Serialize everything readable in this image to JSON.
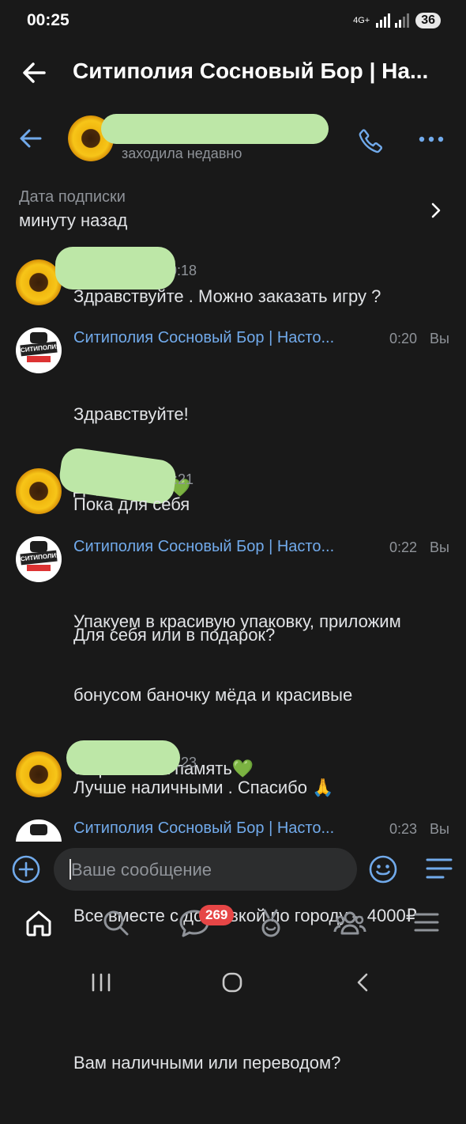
{
  "status": {
    "time": "00:25",
    "network": "4G+",
    "battery": "36"
  },
  "top": {
    "title": "Ситиполия Сосновый Бор | На..."
  },
  "chat": {
    "status": "заходила недавно"
  },
  "subscription": {
    "label": "Дата подписки",
    "value": "минуту назад"
  },
  "messages": [
    {
      "time": "0:18",
      "text": "Здравствуйте . Можно заказать игру ?"
    },
    {
      "author": "Ситиполия Сосновый Бор | Насто...",
      "time": "0:20",
      "you": "Вы",
      "lines": [
        "Здравствуйте!",
        "Да, конечно💚",
        "",
        "Для себя или в подарок?"
      ]
    },
    {
      "time": "0:21",
      "text": "Пока для себя"
    },
    {
      "author": "Ситиполия Сосновый Бор | Насто...",
      "time": "0:22",
      "you": "Вы",
      "lines": [
        "Упакуем в красивую упаковку, приложим",
        "бонусом баночку мёда и красивые",
        "открытки на память💚",
        "",
        "Все вместе с доставкой по городу – 4000₽",
        "",
        "Вам наличными или переводом?"
      ]
    },
    {
      "time": "0:23",
      "text": "Лучше наличными . Спасибо 🙏"
    },
    {
      "author": "Ситиполия Сосновый Бор | Насто...",
      "time": "0:23",
      "you": "Вы"
    }
  ],
  "logo_text": "СИТИПОЛИЯ",
  "input": {
    "placeholder": "Ваше сообщение"
  },
  "nav": {
    "messages_badge": "269"
  },
  "colors": {
    "accent": "#71aaeb",
    "background": "#191919",
    "badge": "#e64646",
    "redaction": "#bde7a7"
  }
}
